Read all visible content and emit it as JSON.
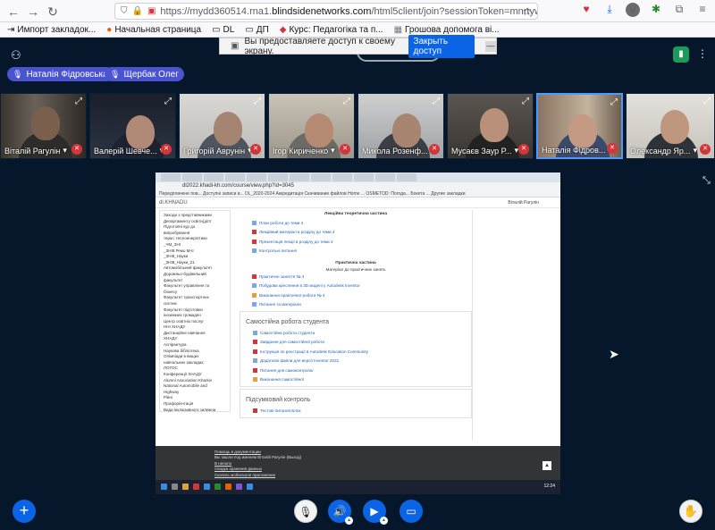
{
  "browser": {
    "url_prefix": "https://mydd360514.rna1.",
    "url_domain": "blindsidenetworks.com",
    "url_suffix": "/html5client/join?sessionToken=mnrtywlf0oxbkchg",
    "profile_initial": "V"
  },
  "bookmarks": [
    {
      "label": "Импорт закладок..."
    },
    {
      "label": "Начальная страница"
    },
    {
      "label": "DL"
    },
    {
      "label": "ДП"
    },
    {
      "label": "Курс: Педагогіка та п..."
    },
    {
      "label": "Грошова допомога ві..."
    }
  ],
  "share_notice": {
    "text": "Вы предоставляете доступ к своему экрану.",
    "button": "Закрыть доступ",
    "close": "—"
  },
  "talkers": [
    {
      "name": "Наталія Фідровська"
    },
    {
      "name": "Щербак Олег"
    }
  ],
  "webcams": [
    {
      "name": "Віталій Рагулін"
    },
    {
      "name": "Валерій Шевче..."
    },
    {
      "name": "Григорій Аврунін"
    },
    {
      "name": "Ігор Кириченко"
    },
    {
      "name": "Микола Розенф..."
    },
    {
      "name": "Мусаєв Заур Р..."
    },
    {
      "name": "Наталія Фідров..."
    },
    {
      "name": "Олександр Яр..."
    }
  ],
  "shared_screen": {
    "inner_url": "dl2022.khadi-kh.com/course/view.php?id=3045",
    "inner_bookmarks": "Передплачене пов... Доступні записи в... DL_2020-2024 Аккредитація Скачивание файлов Home ... OSMETOD: Погода... Бокета ... Другие закладки",
    "site_name": "dl.KHNADU",
    "user_name": "Віталій Рагулін",
    "sidebar": [
      "Заходи з представниками",
      "Департаменту освіти(ділт",
      "Підготовчі кур до",
      "випробування",
      "терм і теплоенергетики",
      "_ЧМ_ЗНІ",
      "_ЗНІ8 Ремо МАІ",
      "_ЗНІ8_Науки",
      "_ЗНІ8_Науки_21",
      "Автомобільний факультет",
      "Дорожньо-будівельний",
      "факультет",
      "Факультет управління та",
      "бізнесу",
      "Факультет транспортних",
      "систем",
      "Факультет підготовки",
      "іноземних громадян",
      "Центр освітніх послуг",
      "ННІ ХНАДУ",
      "Дистанційне навчання",
      "ХНАДУ",
      "Аспірантура",
      "Наукова бібліотека",
      "Олімпіади в вищих",
      "навчальних закладах",
      "ЛОТОС",
      "Конференції ХНАДУ",
      "Alumni Association Kharkiv",
      "National Automobile and",
      "Highway",
      "Рівні",
      "Профорієнтація",
      "Види інклюзивного залежна"
    ],
    "lecture_heading": "Лекційна теоретична частина",
    "lecture_items": [
      "План роботи до теми 4",
      "Лекційний матеріал в розділу до теми 4",
      "Презентація лекції в розділу до теми 4",
      "Контрольні питання"
    ],
    "practice_heading": "Практична частина",
    "practice_sub": "Матеріал до практичних занять",
    "practice_items": [
      "Практичне заняття № 4",
      "Побудова креслення в 3D моделі у Autodesk Inventor",
      "Виконання практичної роботи № 4",
      "Питання та матеріали"
    ],
    "self_heading": "Самостійна робота студента",
    "self_items": [
      "Самостійна робота студента",
      "Завдання для самостійної роботи",
      "Інструкція по реєстрації в Autodesk Education Community",
      "Додаткові файли для версії Inventor 2021",
      "Питання для самоконтролю",
      "Виконання самостійної"
    ],
    "final_heading": "Підсумковий контроль",
    "final_items": [
      "Тестові питання Блок"
    ],
    "footer_lines": [
      "Помощь в документации",
      "Вы зашли под именем Віталій Рагулін (Выход)",
      "В начало",
      "Сводка хранения данных",
      "Скачать мобильное приложение"
    ],
    "clock": "12:24"
  },
  "bottom": {
    "actions": "+",
    "mic_icon": "mic-off",
    "raise_hand": "✋"
  },
  "colors": {
    "app_bg": "#06172c",
    "primary": "#0b63e5",
    "talker_bg": "#4a54d1",
    "mute_red": "#d4353a",
    "active_cam_border": "#4b9aff"
  }
}
